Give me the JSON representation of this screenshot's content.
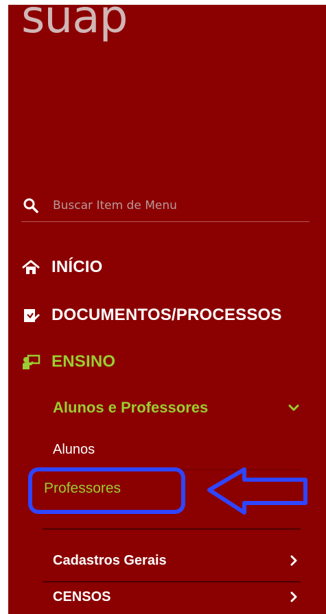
{
  "brand": {
    "logo_text": "suap",
    "logo_color": "#d1b6b6"
  },
  "search": {
    "placeholder": "Buscar Item de Menu"
  },
  "nav": {
    "inicio": {
      "label": "INÍCIO",
      "icon": "home-icon"
    },
    "documentos": {
      "label": "DOCUMENTOS/PROCESSOS",
      "icon": "document-edit-icon"
    },
    "ensino": {
      "label": "ENSINO",
      "icon": "teaching-board-icon",
      "active_color": "#9acd32"
    }
  },
  "submenu": {
    "alunos_professores": {
      "label": "Alunos e Professores",
      "icon": "chevron-down-icon"
    },
    "alunos": {
      "label": "Alunos"
    },
    "professores": {
      "label": "Professores"
    },
    "cadastros_gerais": {
      "label": "Cadastros Gerais",
      "icon": "chevron-right-icon"
    },
    "censos": {
      "label": "CENSOS",
      "icon": "chevron-right-icon"
    }
  },
  "colors": {
    "background": "#8b0000",
    "text": "#ffffff",
    "active": "#9acd32",
    "annotation": "#2f45ff"
  }
}
